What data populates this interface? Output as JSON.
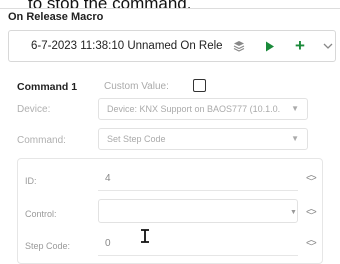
{
  "caption": "to stop the command.",
  "macro": {
    "title": "On Release Macro",
    "header_text": "6-7-2023 11:38:10 Unnamed On Rele"
  },
  "header_icons": {
    "stack": "layers-icon",
    "play": "play-icon",
    "add": "plus-icon",
    "expand": "chevron-down-icon"
  },
  "command": {
    "label": "Command 1",
    "custom_value_label": "Custom Value:",
    "custom_value_checked": false,
    "device_label": "Device:",
    "device_value": "Device: KNX Support on BAOS777 (10.1.0.",
    "command_label": "Command:",
    "command_value": "Set Step Code"
  },
  "params": {
    "id_label": "ID:",
    "id_value": "4",
    "control_label": "Control:",
    "control_value": "",
    "step_code_label": "Step Code:",
    "step_code_value": "0"
  },
  "colors": {
    "play": "#1a8a3a",
    "plus": "#1a8a3a",
    "label_gray": "#b0b0b0"
  }
}
